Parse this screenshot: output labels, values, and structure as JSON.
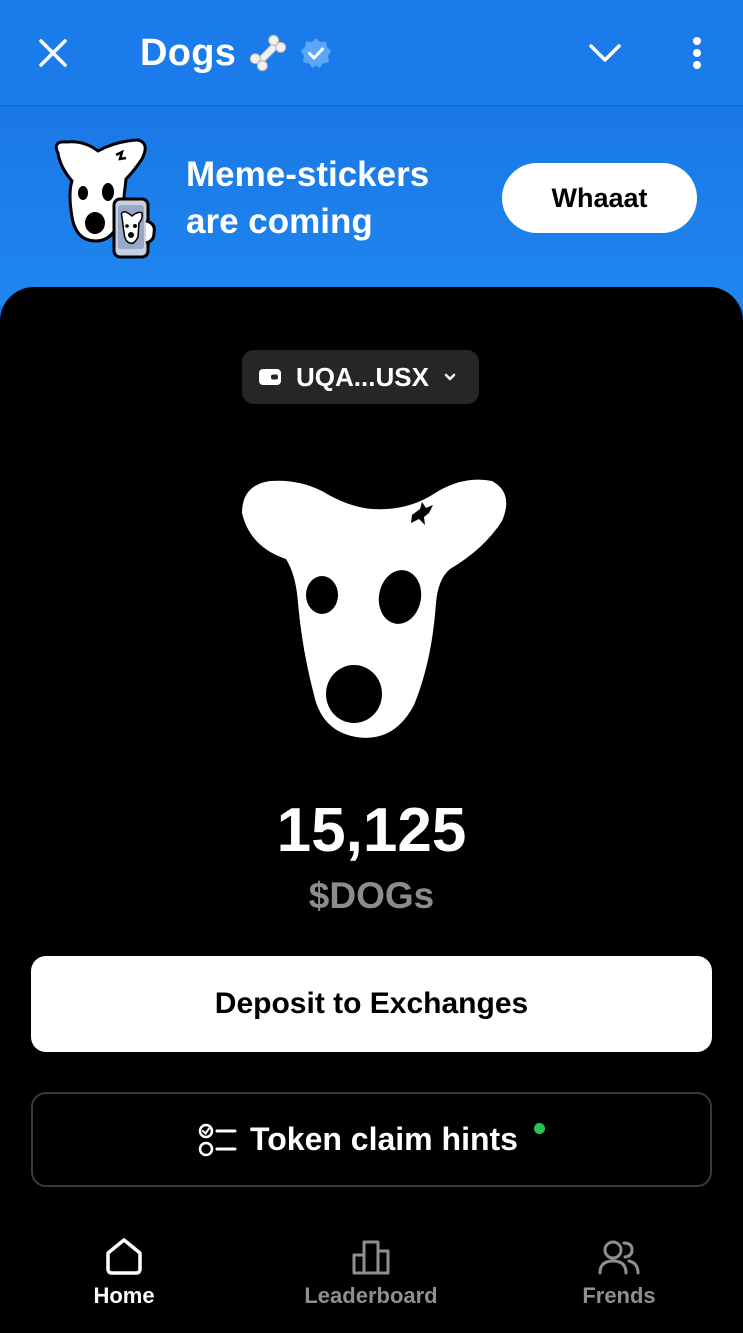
{
  "header": {
    "title": "Dogs",
    "icons": [
      "close-icon",
      "bone-emoji-icon",
      "verified-badge-icon",
      "chevron-down-icon",
      "more-vertical-icon"
    ]
  },
  "banner": {
    "line1": "Meme-stickers",
    "line2": "are coming",
    "button_label": "Whaaat"
  },
  "wallet": {
    "address": "UQA...USX"
  },
  "balance": {
    "amount": "15,125",
    "unit": "$DOGs"
  },
  "actions": {
    "deposit_label": "Deposit to Exchanges",
    "hints_label": "Token claim hints"
  },
  "tabs": [
    {
      "label": "Home",
      "icon": "home-icon",
      "active": true
    },
    {
      "label": "Leaderboard",
      "icon": "leaderboard-icon",
      "active": false
    },
    {
      "label": "Frends",
      "icon": "friends-icon",
      "active": false
    }
  ],
  "colors": {
    "header_blue": "#1b7bea",
    "card_bg": "#000000",
    "notification_dot": "#29c35a",
    "inactive_text": "#8f8f8f"
  }
}
